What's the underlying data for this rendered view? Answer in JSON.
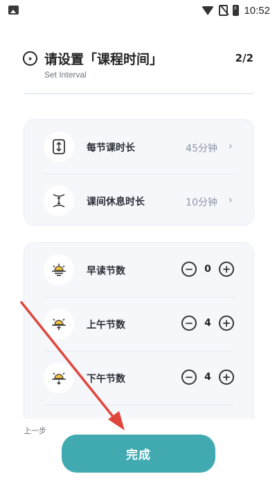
{
  "status_bar": {
    "time": "10:52",
    "icons": [
      "image-icon",
      "wifi-icon",
      "no-sim-icon",
      "battery-charging-icon"
    ]
  },
  "header": {
    "title": "请设置「课程时间」",
    "subtitle": "Set Interval",
    "step": "2/2",
    "icon": "double-chevron-right-circle-icon"
  },
  "duration_settings": [
    {
      "label": "每节课时长",
      "value": "45分钟",
      "icon": "vertical-expand-icon"
    },
    {
      "label": "课间休息时长",
      "value": "10分钟",
      "icon": "break-interval-icon"
    }
  ],
  "period_counts": [
    {
      "label": "早读节数",
      "count": "0",
      "icon": "sunrise-icon"
    },
    {
      "label": "上午节数",
      "count": "4",
      "icon": "sun-up-icon"
    },
    {
      "label": "下午节数",
      "count": "4",
      "icon": "sun-down-icon"
    }
  ],
  "stepper": {
    "minus_symbol": "−",
    "plus_symbol": "+"
  },
  "footer": {
    "prev_label": "上一步",
    "done_label": "完成"
  },
  "colors": {
    "accent": "#40aab0",
    "card_bg": "#f5f7fb",
    "sun": "#f6c23e",
    "annotation_arrow": "#e0463c"
  }
}
